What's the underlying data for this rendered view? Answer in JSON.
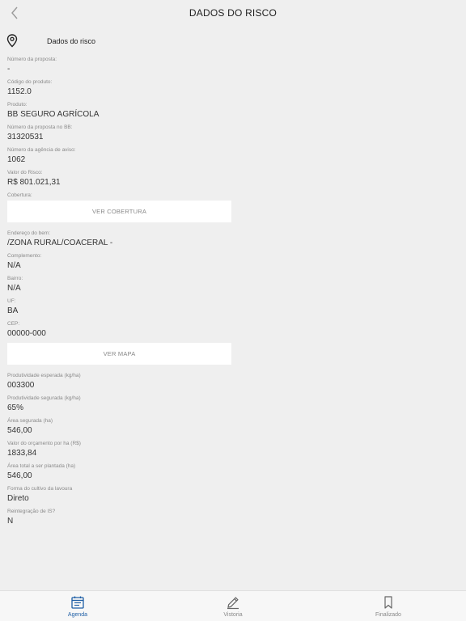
{
  "header": {
    "title": "DADOS DO RISCO"
  },
  "section": {
    "title": "Dados do risco"
  },
  "fields_a": [
    {
      "label": "Número da proposta:",
      "value": "-"
    },
    {
      "label": "Código do produto:",
      "value": "1152.0"
    },
    {
      "label": "Produto:",
      "value": "BB SEGURO AGRÍCOLA"
    },
    {
      "label": "Número da proposta no BB:",
      "value": "31320531"
    },
    {
      "label": "Número da agência de aviso:",
      "value": "1062"
    },
    {
      "label": "Valor do Risco:",
      "value": "R$ 801.021,31"
    }
  ],
  "cobertura": {
    "label": "Cobertura:",
    "button": "VER COBERTURA"
  },
  "fields_b": [
    {
      "label": "Endereço do bem:",
      "value": "/ZONA RURAL/COACERAL -"
    },
    {
      "label": "Complemento:",
      "value": "N/A"
    },
    {
      "label": "Bairro:",
      "value": "N/A"
    },
    {
      "label": "UF:",
      "value": "BA"
    },
    {
      "label": "CEP:",
      "value": "00000-000"
    }
  ],
  "mapa": {
    "button": "VER MAPA"
  },
  "fields_c": [
    {
      "label": "Produtividade esperada (kg/ha)",
      "value": "003300"
    },
    {
      "label": "Produtividade segurada (kg/ha)",
      "value": "65%"
    },
    {
      "label": "Área segurada (ha)",
      "value": "546,00"
    },
    {
      "label": "Valor do orçamento por ha (R$)",
      "value": "1833,84"
    },
    {
      "label": "Área total a ser plantada (ha)",
      "value": "546,00"
    },
    {
      "label": "Forma do cultivo da lavoura",
      "value": "Direto"
    },
    {
      "label": "Reintegração de IS?",
      "value": "N"
    }
  ],
  "tabs": [
    {
      "label": "Agenda",
      "icon": "calendar-icon",
      "active": true
    },
    {
      "label": "Vistoria",
      "icon": "pencil-icon",
      "active": false
    },
    {
      "label": "Finalizado",
      "icon": "bookmark-icon",
      "active": false
    }
  ],
  "colors": {
    "accent": "#1f5fa6",
    "background": "#efefef",
    "label": "#8a8a8a"
  }
}
